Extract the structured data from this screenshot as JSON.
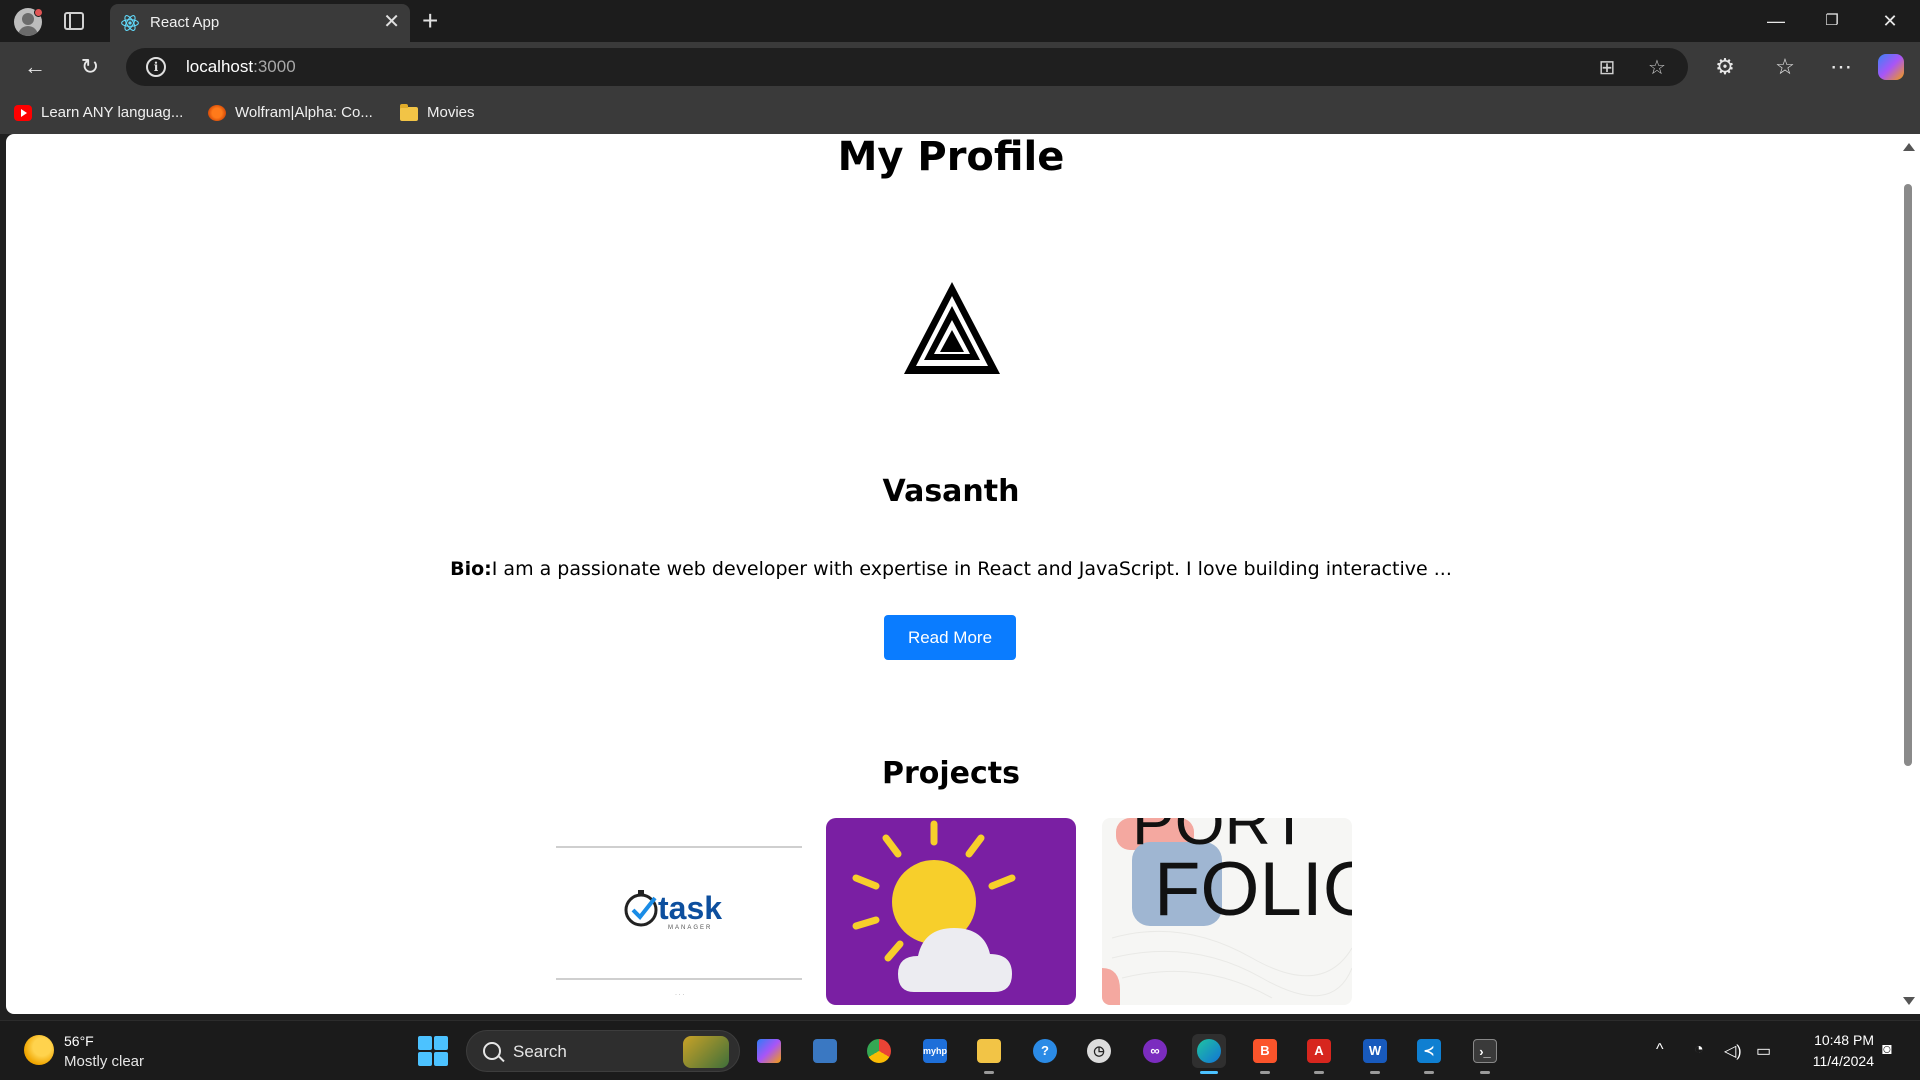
{
  "browser": {
    "tab_title": "React App",
    "url_host": "localhost",
    "url_port": ":3000",
    "bookmarks": [
      {
        "label": "Learn ANY languag...",
        "icon": "youtube-icon"
      },
      {
        "label": "Wolfram|Alpha: Co...",
        "icon": "wolfram-icon"
      },
      {
        "label": "Movies",
        "icon": "folder-icon"
      }
    ]
  },
  "page": {
    "title": "My Profile",
    "name": "Vasanth",
    "bio_label": "Bio:",
    "bio_text": "I am a passionate web developer with expertise in React and JavaScript. I love building interactive ...",
    "read_more_label": "Read More",
    "projects_title": "Projects",
    "projects": [
      {
        "image_text": "task",
        "image_subtext": "MANAGER",
        "icon": "task-manager-logo"
      },
      {
        "icon": "weather-sun-cloud-icon"
      },
      {
        "image_text_top": "PORT",
        "image_text_bottom": "FOLIO",
        "icon": "portfolio-art"
      }
    ]
  },
  "taskbar": {
    "weather_temp": "56°F",
    "weather_desc": "Mostly clear",
    "search_label": "Search",
    "time": "10:48 PM",
    "date": "11/4/2024"
  },
  "colors": {
    "accent_button": "#0a7cff",
    "weather_card": "#7a1fa3"
  }
}
